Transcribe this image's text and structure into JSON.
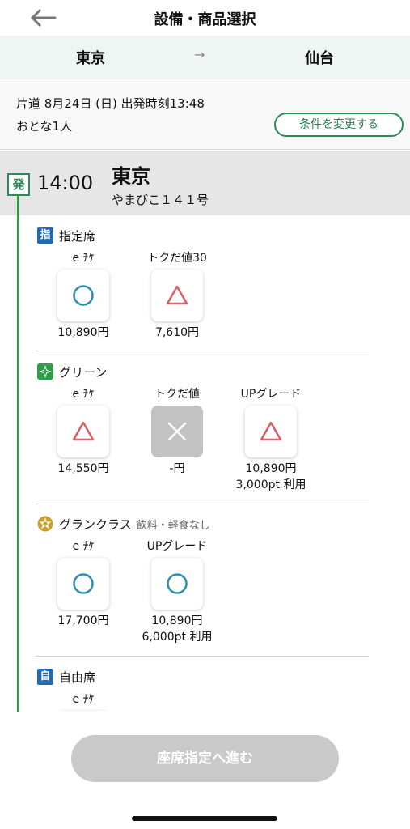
{
  "header": {
    "title": "設備・商品選択"
  },
  "route": {
    "from": "東京",
    "arrow": "→",
    "to": "仙台"
  },
  "conditions": {
    "line1": "片道  8月24日 (日) 出発時刻13:48",
    "line2": "おとな1人",
    "change_button": "条件を変更する"
  },
  "departure": {
    "badge": "発",
    "time": "14:00",
    "station": "東京",
    "train": "やまびこ１４１号"
  },
  "sections": [
    {
      "icon_text": "指",
      "icon": "reserved-seat-icon",
      "label": "指定席",
      "note": "",
      "options": [
        {
          "name": "e ﾁｹ",
          "availability": "○",
          "price": "10,890円",
          "points": ""
        },
        {
          "name": "トクだ値30",
          "availability": "△",
          "price": "7,610円",
          "points": ""
        }
      ]
    },
    {
      "icon_text": "",
      "icon": "green-car-icon",
      "label": "グリーン",
      "note": "",
      "options": [
        {
          "name": "e ﾁｹ",
          "availability": "△",
          "price": "14,550円",
          "points": ""
        },
        {
          "name": "トクだ値",
          "availability": "×",
          "price": "-円",
          "points": ""
        },
        {
          "name": "UPグレード",
          "availability": "△",
          "price": "10,890円",
          "points": "3,000pt 利用"
        }
      ]
    },
    {
      "icon_text": "",
      "icon": "gran-class-icon",
      "label": "グランクラス",
      "note": "飲料・軽食なし",
      "options": [
        {
          "name": "e ﾁｹ",
          "availability": "○",
          "price": "17,700円",
          "points": ""
        },
        {
          "name": "UPグレード",
          "availability": "○",
          "price": "10,890円",
          "points": "6,000pt 利用"
        }
      ]
    },
    {
      "icon_text": "自",
      "icon": "unreserved-seat-icon",
      "label": "自由席",
      "note": "",
      "options": [
        {
          "name": "e ﾁｹ",
          "availability": "",
          "price": "",
          "points": ""
        }
      ]
    }
  ],
  "proceed_button": "座席指定へ進む",
  "colors": {
    "accent_green": "#2e8b57",
    "circle": "#2a8fb0",
    "triangle": "#d95f66",
    "seat_icon_blue": "#2169b3",
    "gran_gold": "#c8a02a"
  }
}
